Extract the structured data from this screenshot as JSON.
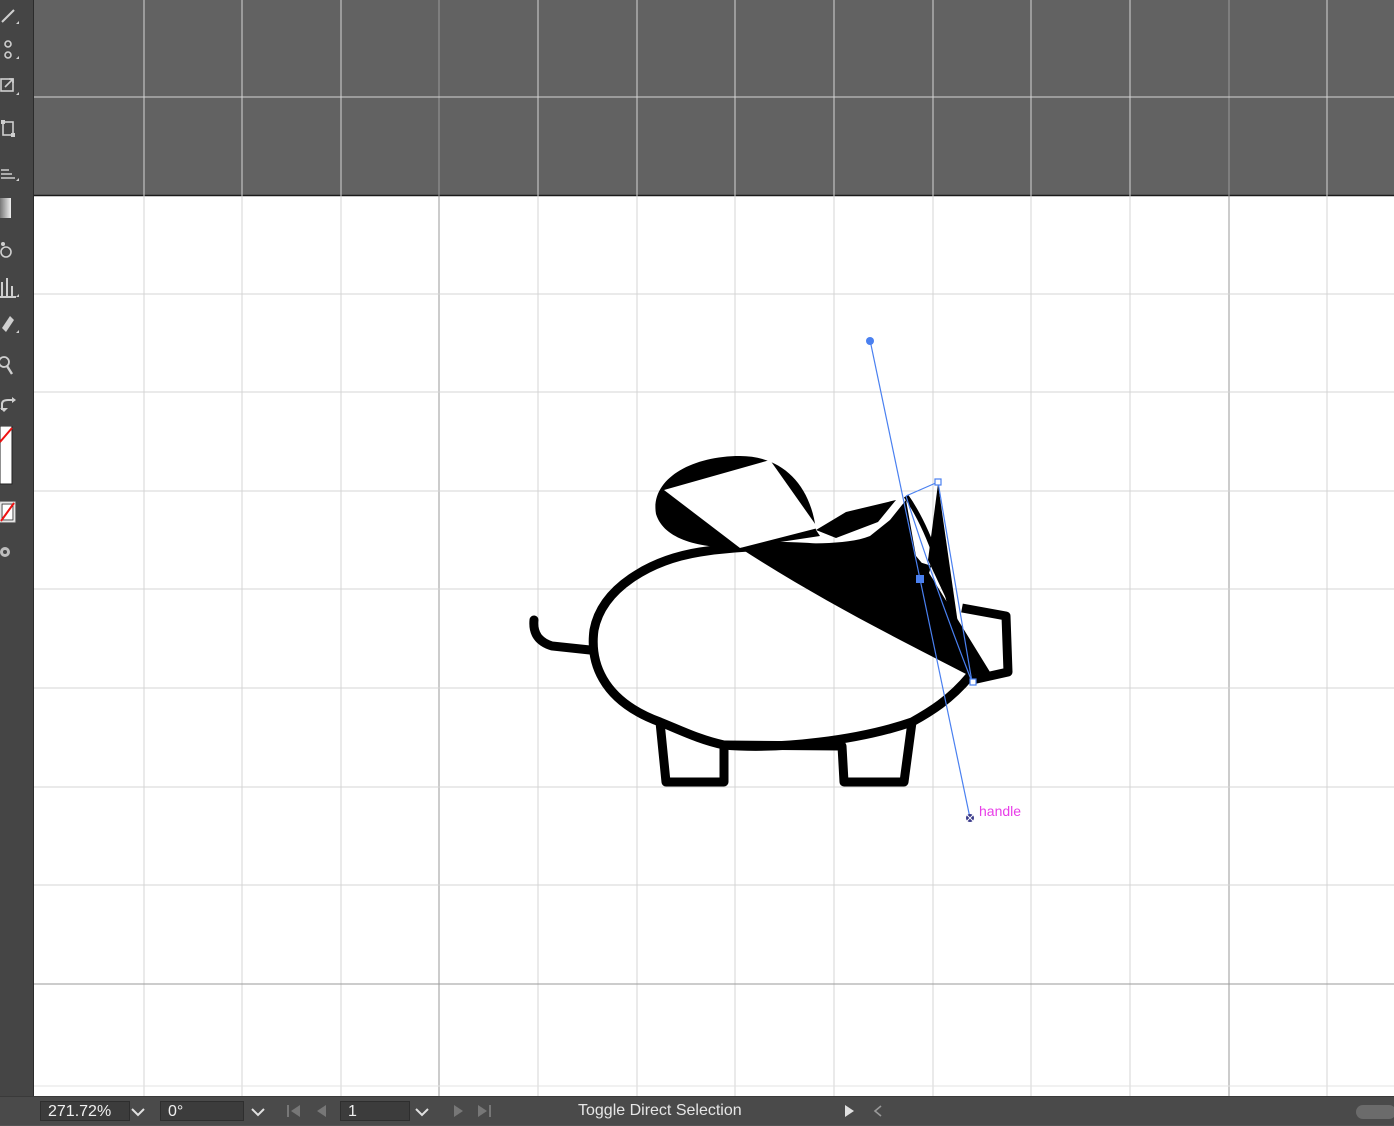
{
  "canvas": {
    "handle_label": "handle"
  },
  "statusbar": {
    "zoom": "271.72%",
    "rotation": "0°",
    "artboard": "1",
    "status_text": "Toggle Direct Selection"
  },
  "colors": {
    "pasteboard": "#626262",
    "artboard": "#ffffff",
    "grid": "#d4d4d4",
    "selection": "#4a80f0",
    "smart_guide_label": "#e83ee8"
  }
}
